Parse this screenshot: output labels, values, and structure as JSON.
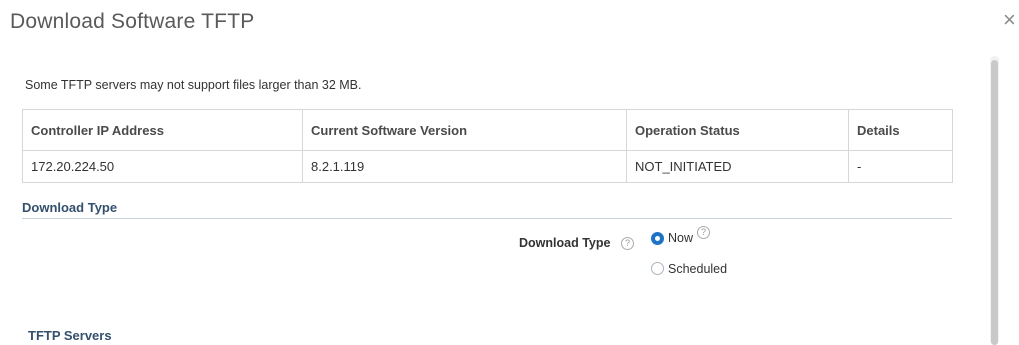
{
  "dialog": {
    "title": "Download Software TFTP",
    "close_icon": "×"
  },
  "notice": "Some TFTP servers may not support files larger than 32 MB.",
  "table": {
    "headers": [
      "Controller IP Address",
      "Current Software Version",
      "Operation Status",
      "Details"
    ],
    "rows": [
      [
        "172.20.224.50",
        "8.2.1.119",
        "NOT_INITIATED",
        "-"
      ]
    ]
  },
  "download_type_section": {
    "header": "Download Type",
    "field_label": "Download Type",
    "help_glyph": "?",
    "options": [
      {
        "label": "Now",
        "selected": true
      },
      {
        "label": "Scheduled",
        "selected": false
      }
    ]
  },
  "tftp_section": {
    "header": "TFTP Servers"
  },
  "colors": {
    "section_header": "#34506e",
    "radio_selected": "#1f73c4"
  }
}
